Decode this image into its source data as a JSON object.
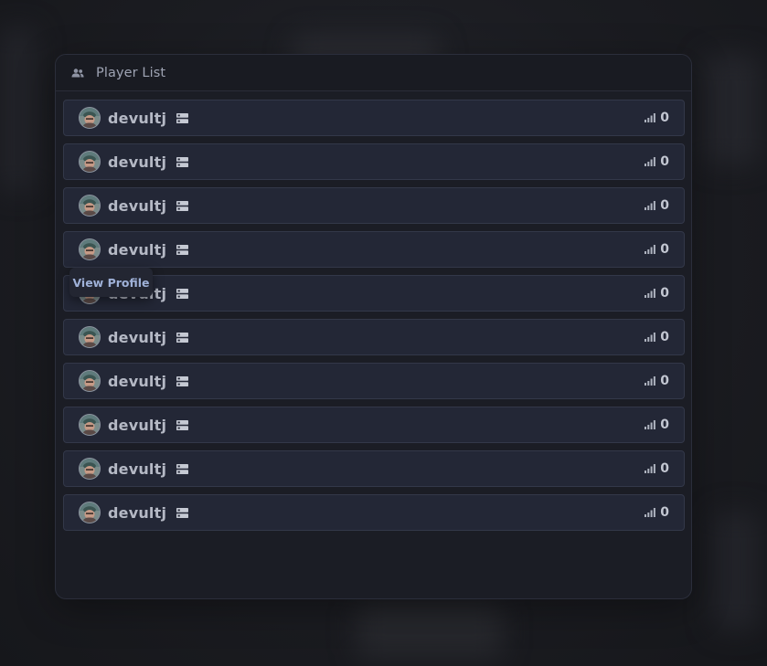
{
  "panel": {
    "title": "Player List",
    "title_icon": "users-icon"
  },
  "players": [
    {
      "name": "devultj",
      "ping": "0"
    },
    {
      "name": "devultj",
      "ping": "0"
    },
    {
      "name": "devultj",
      "ping": "0"
    },
    {
      "name": "devultj",
      "ping": "0"
    },
    {
      "name": "devultj",
      "ping": "0"
    },
    {
      "name": "devultj",
      "ping": "0"
    },
    {
      "name": "devultj",
      "ping": "0"
    },
    {
      "name": "devultj",
      "ping": "0"
    },
    {
      "name": "devultj",
      "ping": "0"
    },
    {
      "name": "devultj",
      "ping": "0"
    }
  ],
  "tooltip": {
    "label": "View Profile"
  },
  "colors": {
    "panel_bg": "#1b1d25",
    "row_bg": "#232736",
    "row_border": "#333849",
    "text": "#b5b9c5",
    "tooltip_text": "#9fb1d8"
  }
}
